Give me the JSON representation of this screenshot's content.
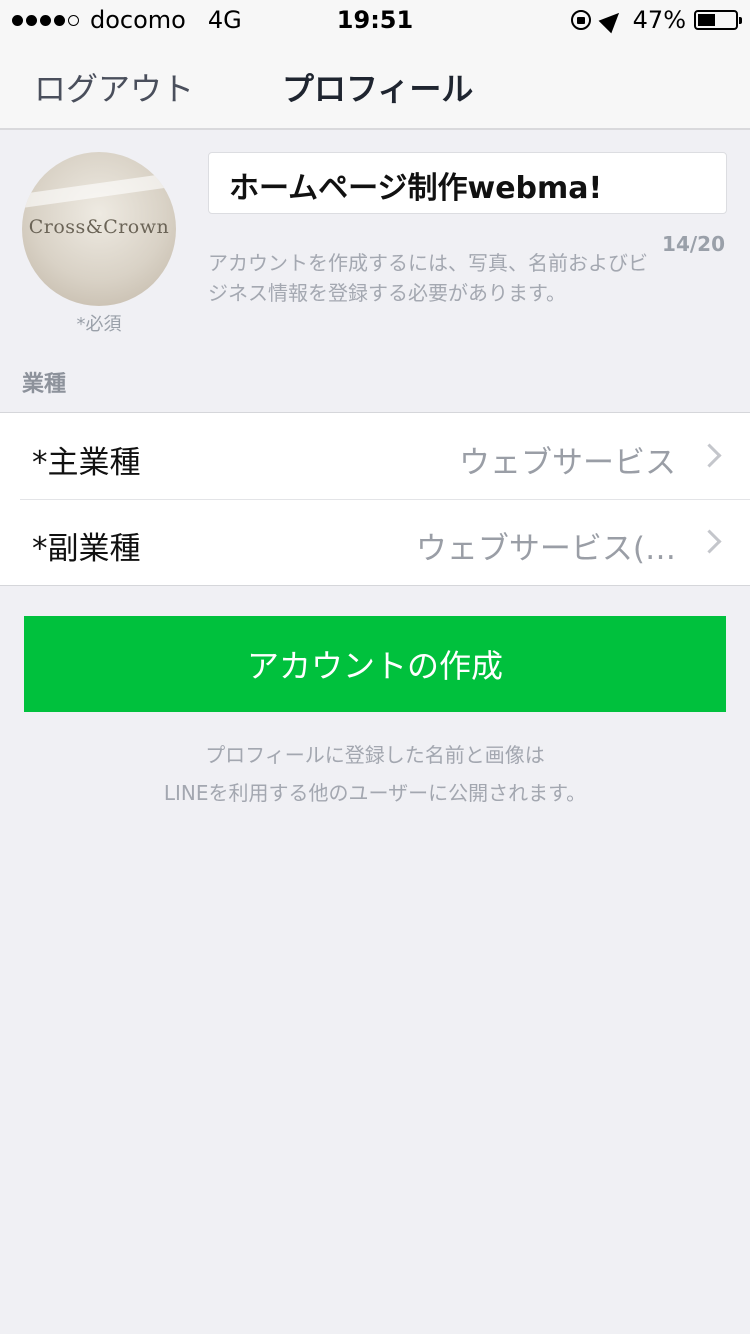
{
  "status_bar": {
    "carrier": "docomo",
    "network": "4G",
    "time": "19:51",
    "battery_percent": "47%",
    "battery_level": 0.47,
    "signal_bars_filled": 4,
    "signal_bars_total": 5
  },
  "nav": {
    "logout_label": "ログアウト",
    "title": "プロフィール"
  },
  "profile": {
    "avatar_text": "Cross&Crown",
    "required_note": "*必須",
    "name_value": "ホームページ制作webma!",
    "char_count": "14/20",
    "help_text": "アカウントを作成するには、写真、名前およびビジネス情報を登録する必要があります。"
  },
  "category_section": {
    "label": "業種",
    "rows": [
      {
        "label": "*主業種",
        "value": "ウェブサービス"
      },
      {
        "label": "*副業種",
        "value": "ウェブサービス(…"
      }
    ]
  },
  "create_button_label": "アカウントの作成",
  "disclaimer": {
    "line1": "プロフィールに登録した名前と画像は",
    "line2": "LINEを利用する他のユーザーに公開されます。"
  },
  "colors": {
    "accent_green": "#00c13d",
    "background": "#f0f0f4"
  }
}
